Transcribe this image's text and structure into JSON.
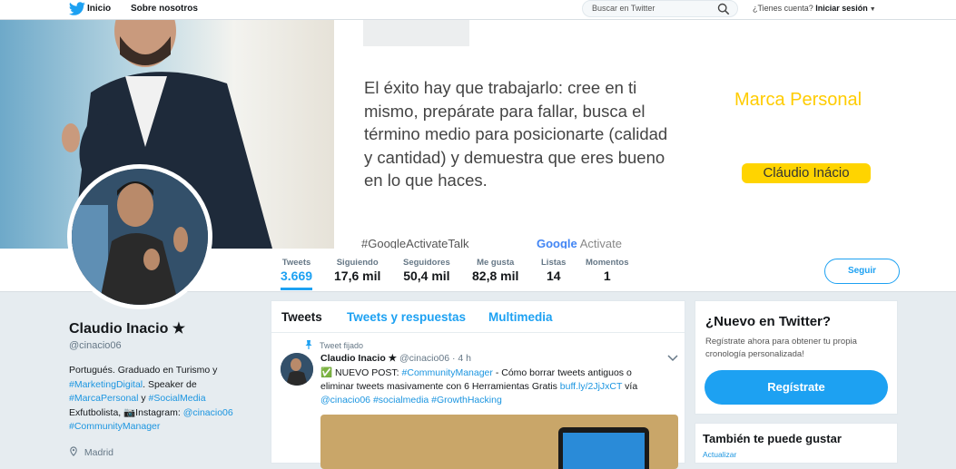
{
  "topbar": {
    "home_label": "Inicio",
    "about_label": "Sobre nosotros",
    "search_placeholder": "Buscar en Twitter",
    "account_question": "¿Tienes cuenta?",
    "login_label": "Iniciar sesión"
  },
  "banner": {
    "quote": "El éxito hay que trabajarlo: cree en ti mismo, prepárate para fallar, busca el término medio para posicionarte (calidad y cantidad) y demuestra que eres bueno en lo que haces.",
    "hashtag": "#GoogleActivateTalk",
    "google_word": "Google",
    "activate_word": "Activate",
    "brand_title": "Marca Personal",
    "brand_name": "Cláudio Inácio"
  },
  "profile_nav": {
    "stats": [
      {
        "label": "Tweets",
        "value": "3.669"
      },
      {
        "label": "Siguiendo",
        "value": "17,6 mil"
      },
      {
        "label": "Seguidores",
        "value": "50,4 mil"
      },
      {
        "label": "Me gusta",
        "value": "82,8 mil"
      },
      {
        "label": "Listas",
        "value": "14"
      },
      {
        "label": "Momentos",
        "value": "1"
      }
    ],
    "follow_label": "Seguir"
  },
  "profile": {
    "name": "Claudio Inacio ★",
    "handle": "@cinacio06",
    "bio_1": "Portugués. Graduado en Turismo y",
    "bio_tag1": "#MarketingDigital",
    "bio_2": ". Speaker de",
    "bio_tag2": "#MarcaPersonal",
    "bio_3": " y ",
    "bio_tag3": "#SocialMedia",
    "bio_4": "Exfutbolista, 📷Instagram: ",
    "bio_mention": "@cinacio06",
    "bio_tag4": "#CommunityManager",
    "location": "Madrid"
  },
  "timeline": {
    "tabs": [
      "Tweets",
      "Tweets y respuestas",
      "Multimedia"
    ],
    "pinned_label": "Tweet fijado",
    "tweet": {
      "author": "Claudio Inacio ★",
      "handle": "@cinacio06",
      "time": "· 4 h",
      "text_1": "✅ NUEVO POST: ",
      "tag1": "#CommunityManager",
      "text_2": " - Cómo borrar tweets antiguos o eliminar tweets masivamente con 6 Herramientas Gratis ",
      "link": "buff.ly/2JjJxCT",
      "text_3": " vía ",
      "mention": "@cinacio06",
      "tag2": "#socialmedia",
      "tag3": "#GrowthHacking"
    }
  },
  "sidebar": {
    "new_title": "¿Nuevo en Twitter?",
    "new_text": "Regístrate ahora para obtener tu propia cronología personalizada!",
    "register_label": "Regístrate",
    "suggest_title": "También te puede gustar",
    "refresh_label": "Actualizar"
  },
  "colors": {
    "twitter_blue": "#1da1f2",
    "brand_yellow": "#ffd400"
  }
}
